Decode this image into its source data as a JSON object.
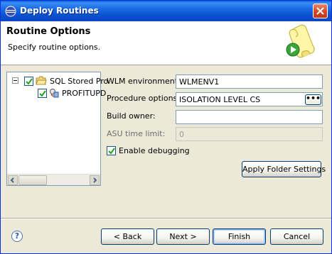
{
  "window": {
    "title": "Deploy Routines"
  },
  "banner": {
    "heading": "Routine Options",
    "subtitle": "Specify routine options."
  },
  "tree": {
    "root_label": "SQL Stored Pro",
    "child_label": "PROFITUPD"
  },
  "form": {
    "wlm_label": "WLM environment:",
    "wlm_value": "WLMENV1",
    "proc_label": "Procedure options:",
    "proc_value": "ISOLATION LEVEL CS",
    "ellipsis_label": "•••",
    "owner_label": "Build owner:",
    "owner_value": "",
    "asu_label": "ASU time limit:",
    "asu_value": "0",
    "debug_label": "Enable debugging",
    "debug_checked": true,
    "apply_label": "Apply Folder Settings"
  },
  "footer": {
    "help_label": "?",
    "back_label": "< Back",
    "next_label": "Next >",
    "finish_label": "Finish",
    "cancel_label": "Cancel"
  }
}
